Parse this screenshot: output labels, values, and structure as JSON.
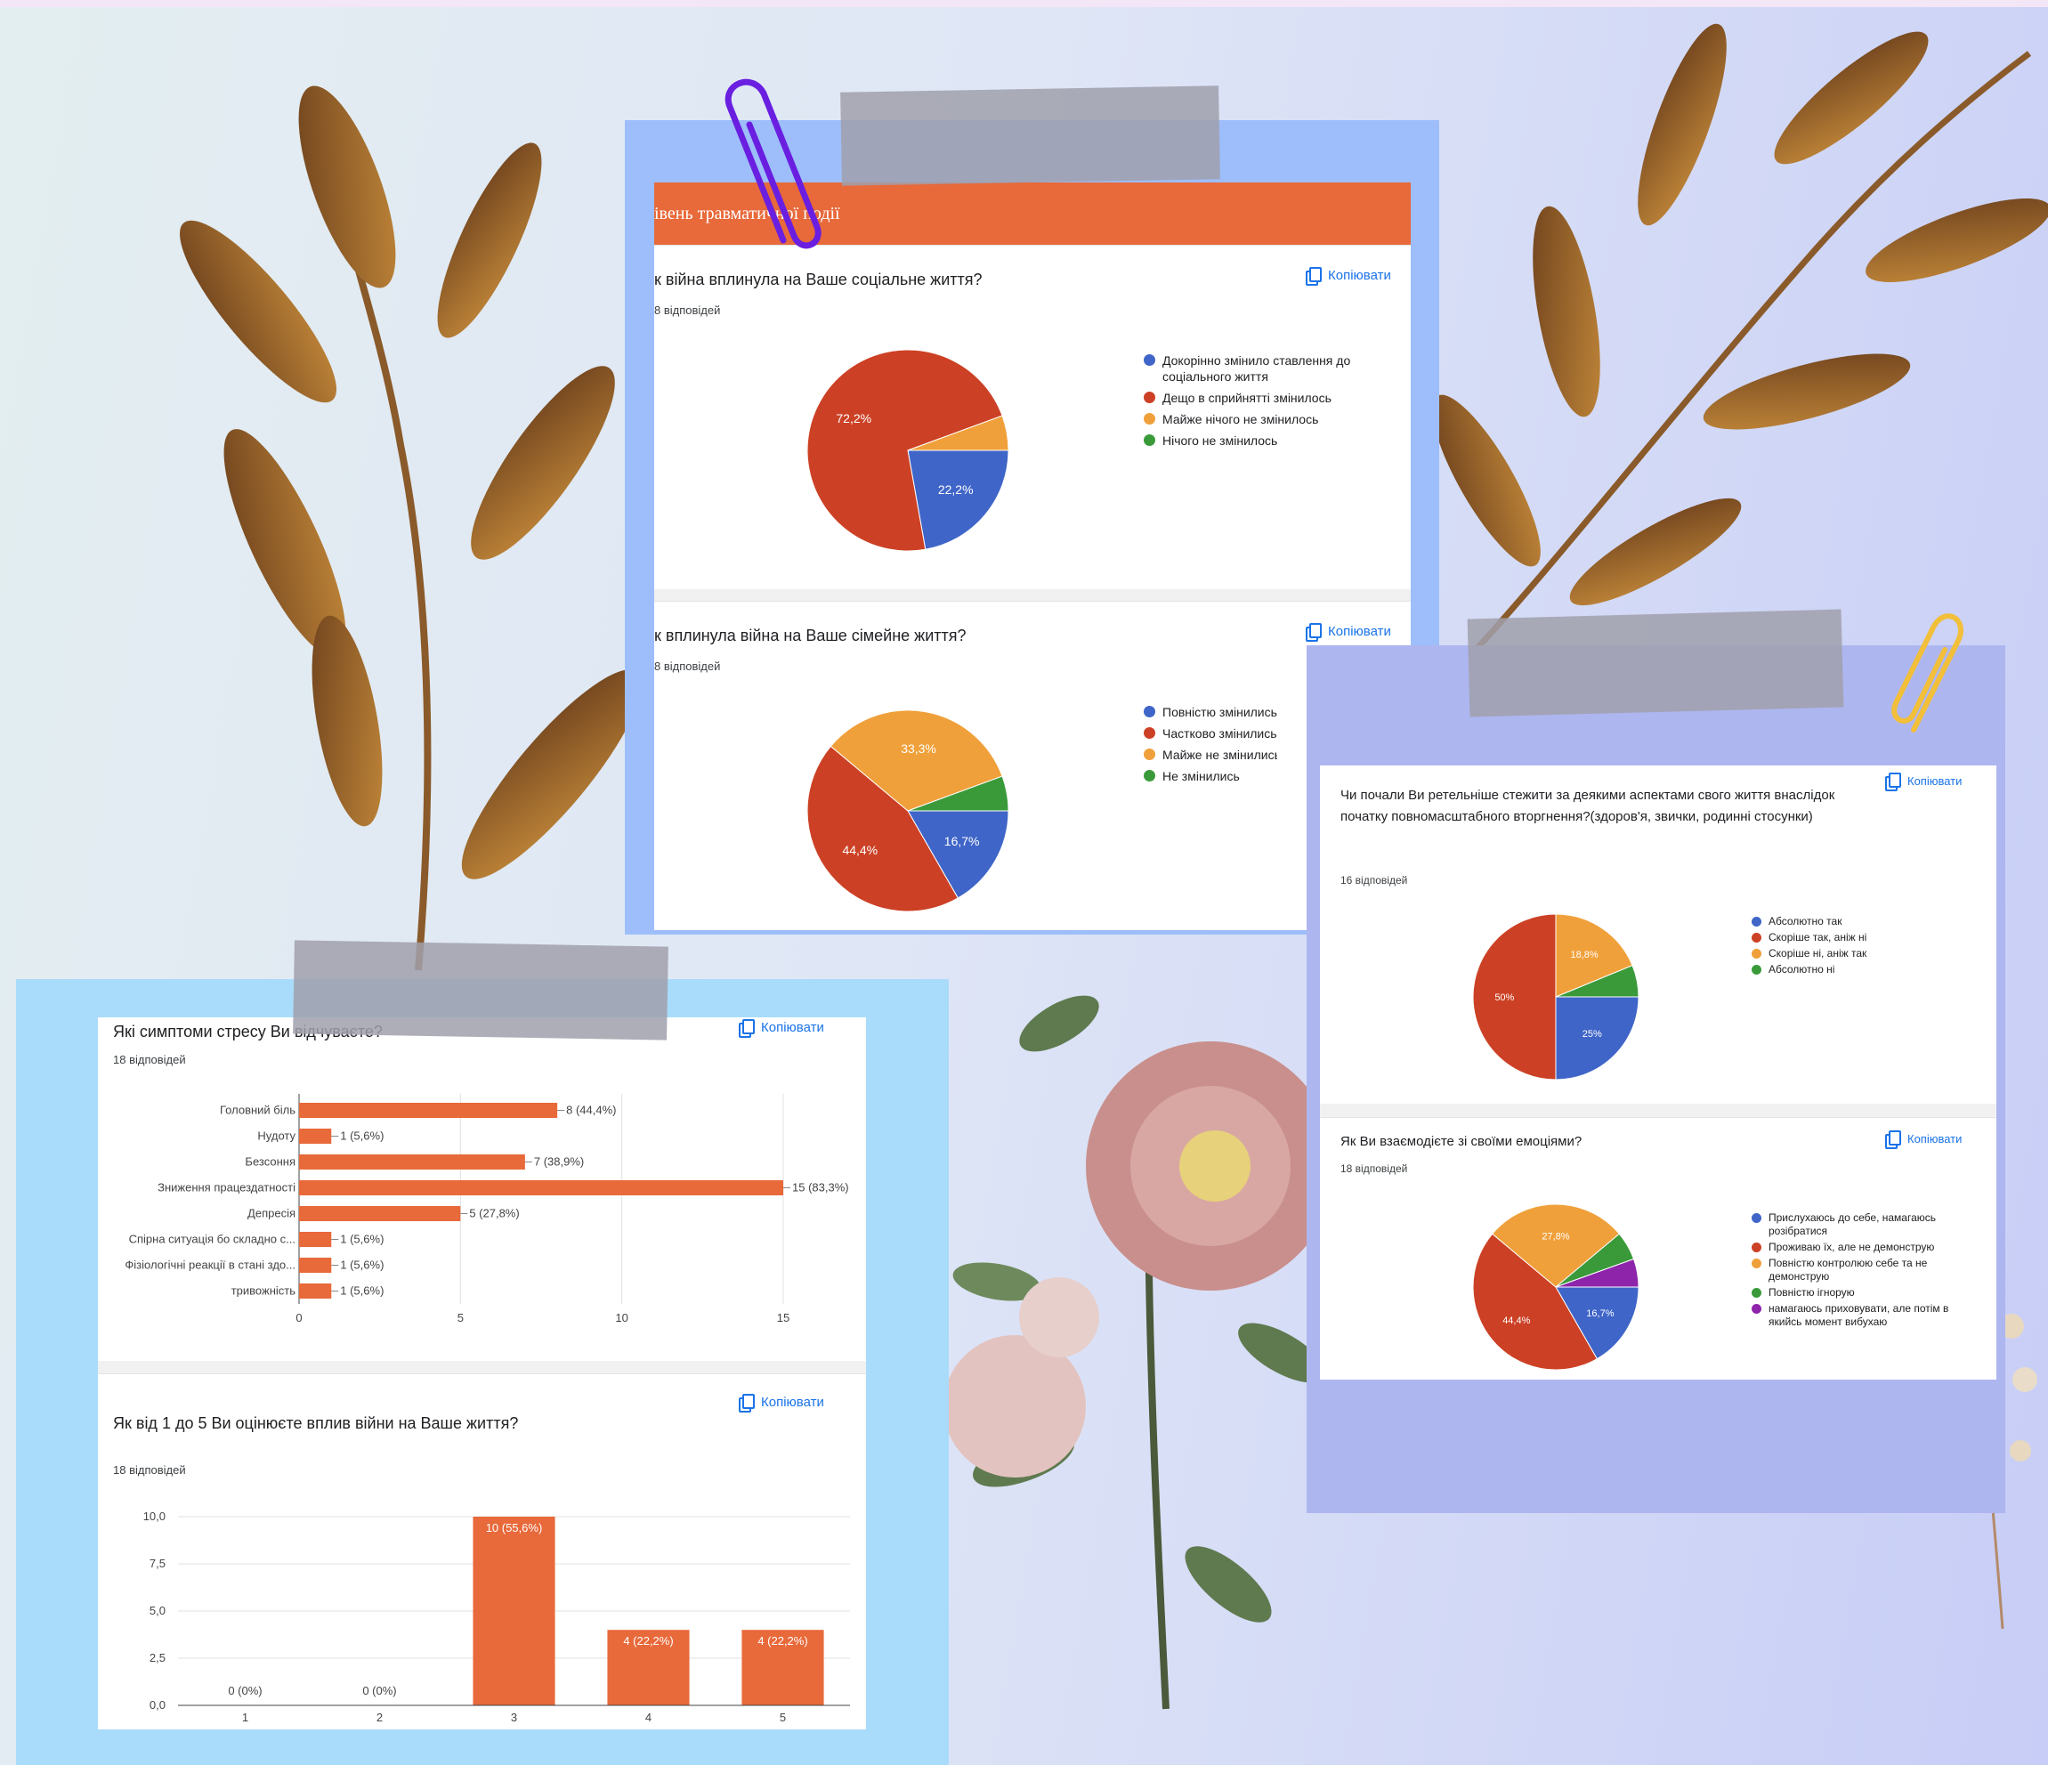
{
  "colors": {
    "accent": "#e8693a",
    "blue": "#3f65c8",
    "red": "#cc4125",
    "orange": "#f0a03a",
    "green": "#3a9a3a",
    "purple": "#8e24aa"
  },
  "copy_label": "Копіювати",
  "top_panel": {
    "header": "івень травматичної події",
    "q1": {
      "title": "к війна вплинула на Ваше соціальне життя?",
      "responses": "8 відповідей",
      "legend": [
        "Докорінно змінило ставлення до соціального життя",
        "Дещо в сприйнятті змінилось",
        "Майже нічого не змінилось",
        "Нічого не змінилось"
      ]
    },
    "q2": {
      "title": "к вплинула війна на Ваше сімейне життя?",
      "responses": "8 відповідей",
      "legend": [
        "Повністю змінились сім",
        "Частково змінились сім",
        "Майже не змінились сім",
        "Не змінились"
      ]
    }
  },
  "left_panel": {
    "q1": {
      "title": "Які симптоми стресу Ви відчуваєте?",
      "responses": "18 відповідей"
    },
    "q2": {
      "title": "Як від 1 до 5 Ви оцінюєте вплив війни на Ваше життя?",
      "responses": "18 відповідей"
    }
  },
  "right_panel": {
    "q1": {
      "title": "Чи почали Ви ретельніше стежити за деякими аспектами свого життя внаслідок початку повномасштабного вторгнення?(здоров'я, звички, родинні стосунки)",
      "responses": "16 відповідей",
      "legend": [
        "Абсолютно так",
        "Скоріше так, аніж ні",
        "Скоріше ні, аніж так",
        "Абсолютно ні"
      ]
    },
    "q2": {
      "title": "Як Ви взаємодієте зі своїми емоціями?",
      "responses": "18 відповідей",
      "legend": [
        "Прислухаюсь до себе, намагаюсь розібратися",
        "Проживаю їх, але не демонструю",
        "Повністю контролюю себе та не демонструю",
        "Повністю ігнорую",
        "намагаюсь приховувати, але потім в якийсь момент вибухаю"
      ]
    }
  },
  "chart_data": [
    {
      "type": "pie",
      "title": "к війна вплинула на Ваше соціальне життя?",
      "labels": [
        "Докорінно змінило ставлення до соціального життя",
        "Дещо в сприйнятті змінилось",
        "Майже нічого не змінилось",
        "Нічого не змінилось"
      ],
      "values": [
        22.2,
        72.2,
        5.6,
        0
      ],
      "value_labels": [
        "22,2%",
        "72,2%",
        "",
        ""
      ],
      "colors": [
        "#3f65c8",
        "#cc4125",
        "#f0a03a",
        "#3a9a3a"
      ]
    },
    {
      "type": "pie",
      "title": "к вплинула війна на Ваше сімейне життя?",
      "labels": [
        "Повністю змінились сім",
        "Частково змінились сім",
        "Майже не змінились сім",
        "Не змінились"
      ],
      "values": [
        16.7,
        44.4,
        33.3,
        5.6
      ],
      "value_labels": [
        "16,7%",
        "44,4%",
        "33,3%",
        ""
      ],
      "colors": [
        "#3f65c8",
        "#cc4125",
        "#f0a03a",
        "#3a9a3a"
      ]
    },
    {
      "type": "bar",
      "orientation": "horizontal",
      "title": "Які симптоми стресу Ви відчуваєте?",
      "categories": [
        "Головний біль",
        "Нудоту",
        "Безсоння",
        "Зниження працездатності",
        "Депресія",
        "Спірна ситуація бо складно с...",
        "Фізіологічні реакції в стані здо...",
        "тривожність"
      ],
      "values": [
        8,
        1,
        7,
        15,
        5,
        1,
        1,
        1
      ],
      "value_labels": [
        "8 (44,4%)",
        "1 (5,6%)",
        "7 (38,9%)",
        "15 (83,3%)",
        "5 (27,8%)",
        "1 (5,6%)",
        "1 (5,6%)",
        "1 (5,6%)"
      ],
      "xticks": [
        "0",
        "5",
        "10",
        "15"
      ],
      "xlim": [
        0,
        15
      ],
      "color": "#e8693a"
    },
    {
      "type": "bar",
      "title": "Як від 1 до 5 Ви оцінюєте вплив війни на Ваше життя?",
      "categories": [
        "1",
        "2",
        "3",
        "4",
        "5"
      ],
      "values": [
        0,
        0,
        10,
        4,
        4
      ],
      "value_labels": [
        "0 (0%)",
        "0 (0%)",
        "10 (55,6%)",
        "4 (22,2%)",
        "4 (22,2%)"
      ],
      "yticks": [
        "0,0",
        "2,5",
        "5,0",
        "7,5",
        "10,0"
      ],
      "ylim": [
        0,
        10
      ],
      "color": "#e8693a"
    },
    {
      "type": "pie",
      "title": "Чи почали Ви ретельніше стежити за деякими аспектами свого життя внаслідок початку повномасштабного вторгнення?(здоров'я, звички, родинні стосунки)",
      "labels": [
        "Абсолютно так",
        "Скоріше так, аніж ні",
        "Скоріше ні, аніж так",
        "Абсолютно ні"
      ],
      "values": [
        25,
        50,
        18.8,
        6.2
      ],
      "value_labels": [
        "25%",
        "50%",
        "18,8%",
        ""
      ],
      "colors": [
        "#3f65c8",
        "#cc4125",
        "#f0a03a",
        "#3a9a3a"
      ]
    },
    {
      "type": "pie",
      "title": "Як Ви взаємодієте зі своїми емоціями?",
      "labels": [
        "Прислухаюсь до себе, намагаюсь розібратися",
        "Проживаю їх, але не демонструю",
        "Повністю контролюю себе та не демонструю",
        "Повністю ігнорую",
        "намагаюсь приховувати, але потім в якийсь момент вибухаю"
      ],
      "values": [
        16.7,
        44.4,
        27.8,
        5.6,
        5.5
      ],
      "value_labels": [
        "16,7%",
        "44,4%",
        "27,8%",
        "",
        ""
      ],
      "colors": [
        "#3f65c8",
        "#cc4125",
        "#f0a03a",
        "#3a9a3a",
        "#8e24aa"
      ]
    }
  ]
}
